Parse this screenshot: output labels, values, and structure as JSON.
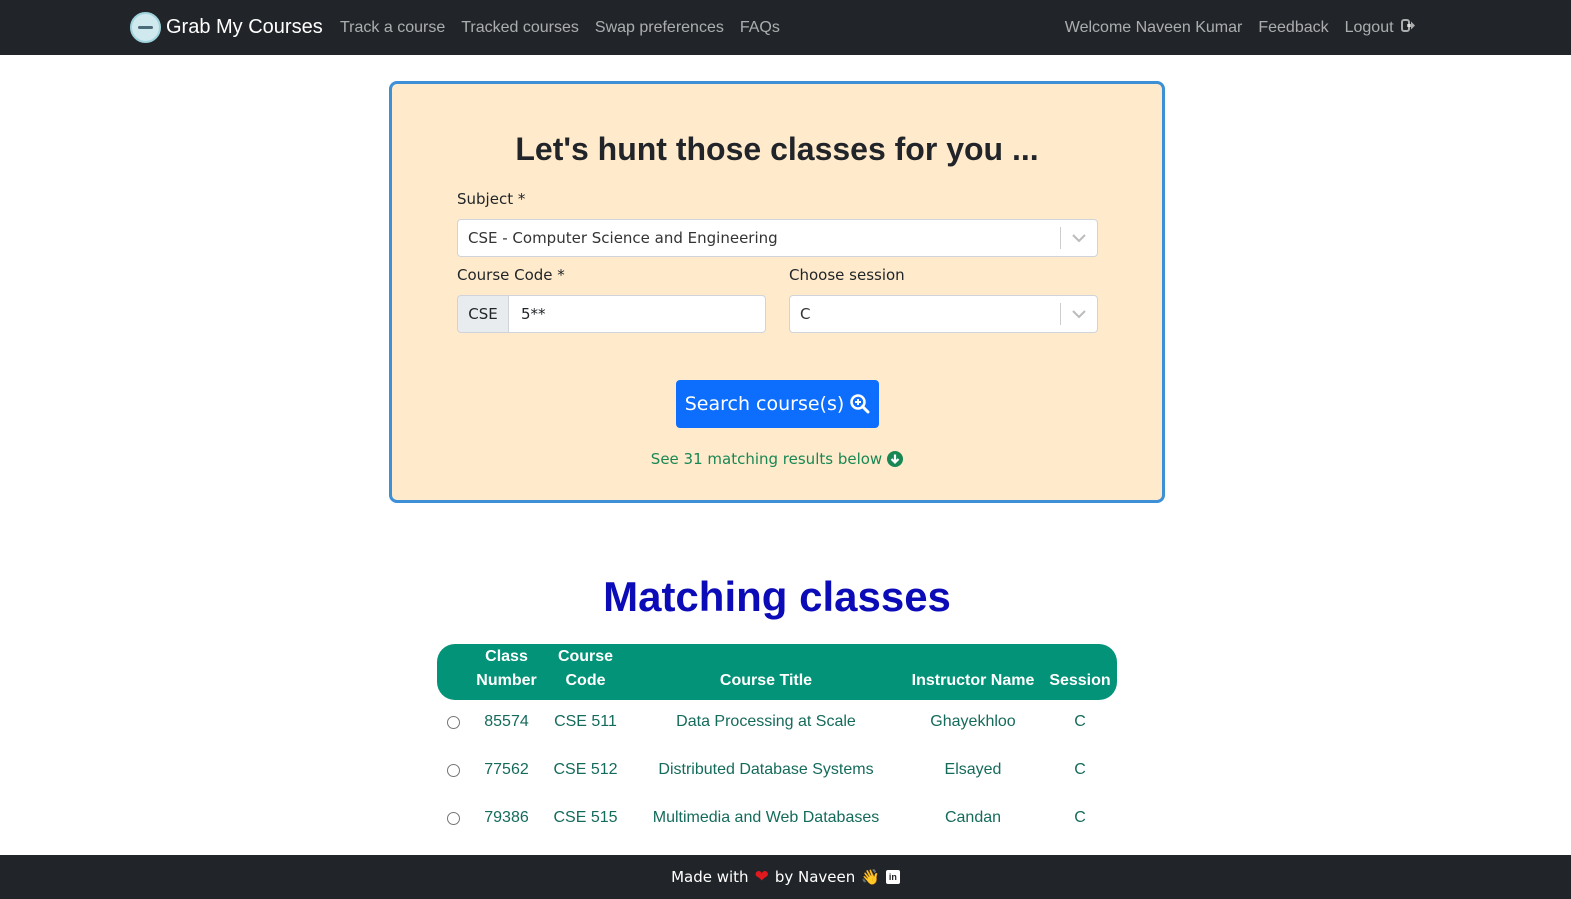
{
  "navbar": {
    "brand": "Grab My Courses",
    "links": [
      "Track a course",
      "Tracked courses",
      "Swap preferences",
      "FAQs"
    ],
    "welcome": "Welcome Naveen Kumar",
    "feedback": "Feedback",
    "logout": "Logout"
  },
  "search": {
    "title": "Let's hunt those classes for you ...",
    "subject_label": "Subject *",
    "subject_value": "CSE - Computer Science and Engineering",
    "course_code_label": "Course Code *",
    "course_code_prefix": "CSE",
    "course_code_value": "5**",
    "session_label": "Choose session",
    "session_value": "C",
    "button_label": "Search course(s)",
    "results_hint": "See 31 matching results below"
  },
  "results": {
    "title": "Matching classes",
    "headers": {
      "class_number_1": "Class",
      "class_number_2": "Number",
      "course_code_1": "Course",
      "course_code_2": "Code",
      "course_title": "Course Title",
      "instructor": "Instructor Name",
      "session": "Session"
    },
    "rows": [
      {
        "class_number": "85574",
        "course_code": "CSE 511",
        "title": "Data Processing at Scale",
        "instructor": "Ghayekhloo",
        "session": "C"
      },
      {
        "class_number": "77562",
        "course_code": "CSE 512",
        "title": "Distributed Database Systems",
        "instructor": "Elsayed",
        "session": "C"
      },
      {
        "class_number": "79386",
        "course_code": "CSE 515",
        "title": "Multimedia and Web Databases",
        "instructor": "Candan",
        "session": "C"
      }
    ]
  },
  "footer": {
    "made_with": "Made with",
    "heart": "❤",
    "by": "by Naveen",
    "wave": "👋",
    "linkedin": "in"
  },
  "colors": {
    "navbar": "#212529",
    "card_bg": "#ffebcc",
    "card_border": "#3d8fd6",
    "primary": "#0d6efd",
    "success": "#198754",
    "table_head": "#039378",
    "matching_title": "#0b0bb8"
  }
}
